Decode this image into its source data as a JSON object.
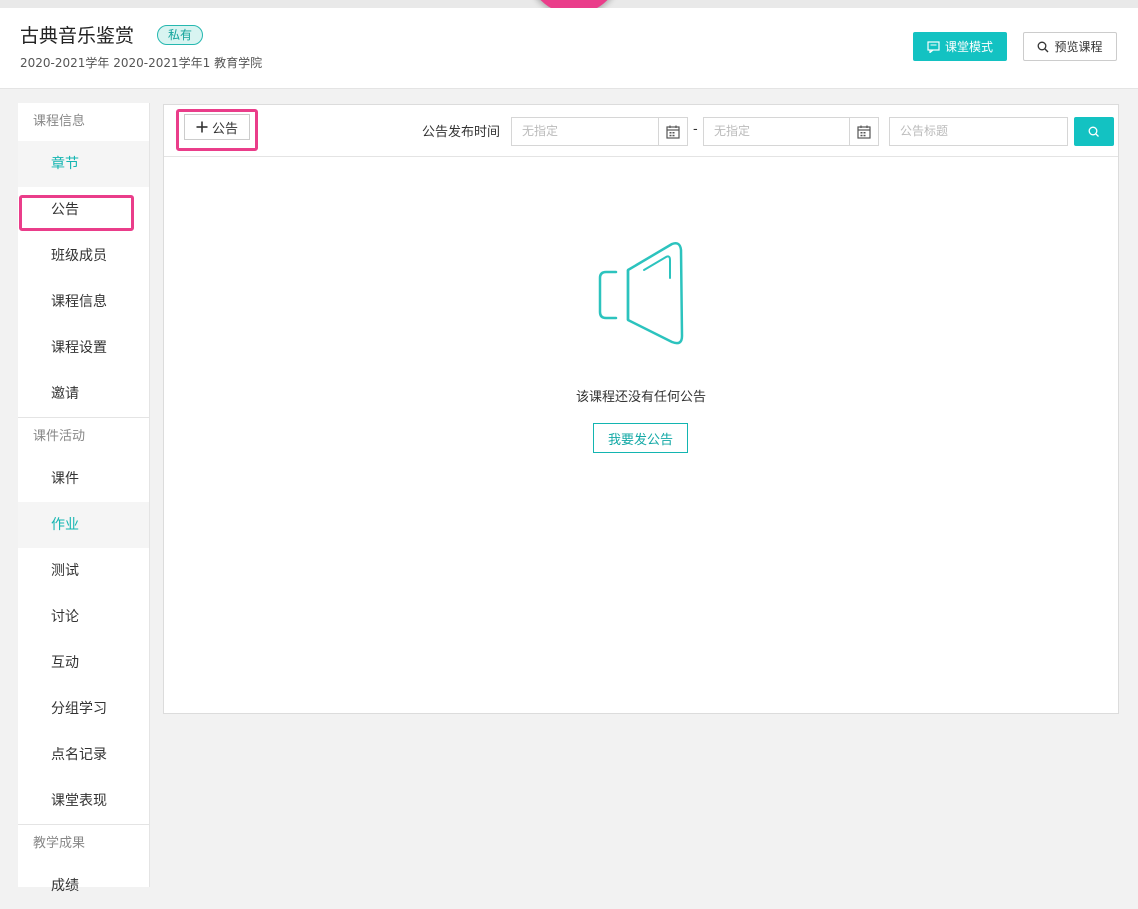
{
  "header": {
    "title": "古典音乐鉴赏",
    "badge": "私有",
    "meta": "2020-2021学年 2020-2021学年1 教育学院",
    "classroom_mode": "课堂模式",
    "preview_course": "预览课程"
  },
  "sidebar": {
    "section_course_info": "课程信息",
    "items_course_info": [
      "章节",
      "公告",
      "班级成员",
      "课程信息",
      "课程设置",
      "邀请"
    ],
    "section_activities": "课件活动",
    "items_activities": [
      "课件",
      "作业",
      "测试",
      "讨论",
      "互动",
      "分组学习",
      "点名记录",
      "课堂表现"
    ],
    "section_results": "教学成果",
    "items_results": [
      "成绩"
    ]
  },
  "toolbar": {
    "add_label": "公告",
    "date_label": "公告发布时间",
    "date_start_placeholder": "无指定",
    "date_separator": "-",
    "date_end_placeholder": "无指定",
    "title_placeholder": "公告标题"
  },
  "empty": {
    "message": "该课程还没有任何公告",
    "publish_button": "我要发公告"
  },
  "colors": {
    "accent": "#13c2c2",
    "highlight": "#ea3d8a"
  }
}
